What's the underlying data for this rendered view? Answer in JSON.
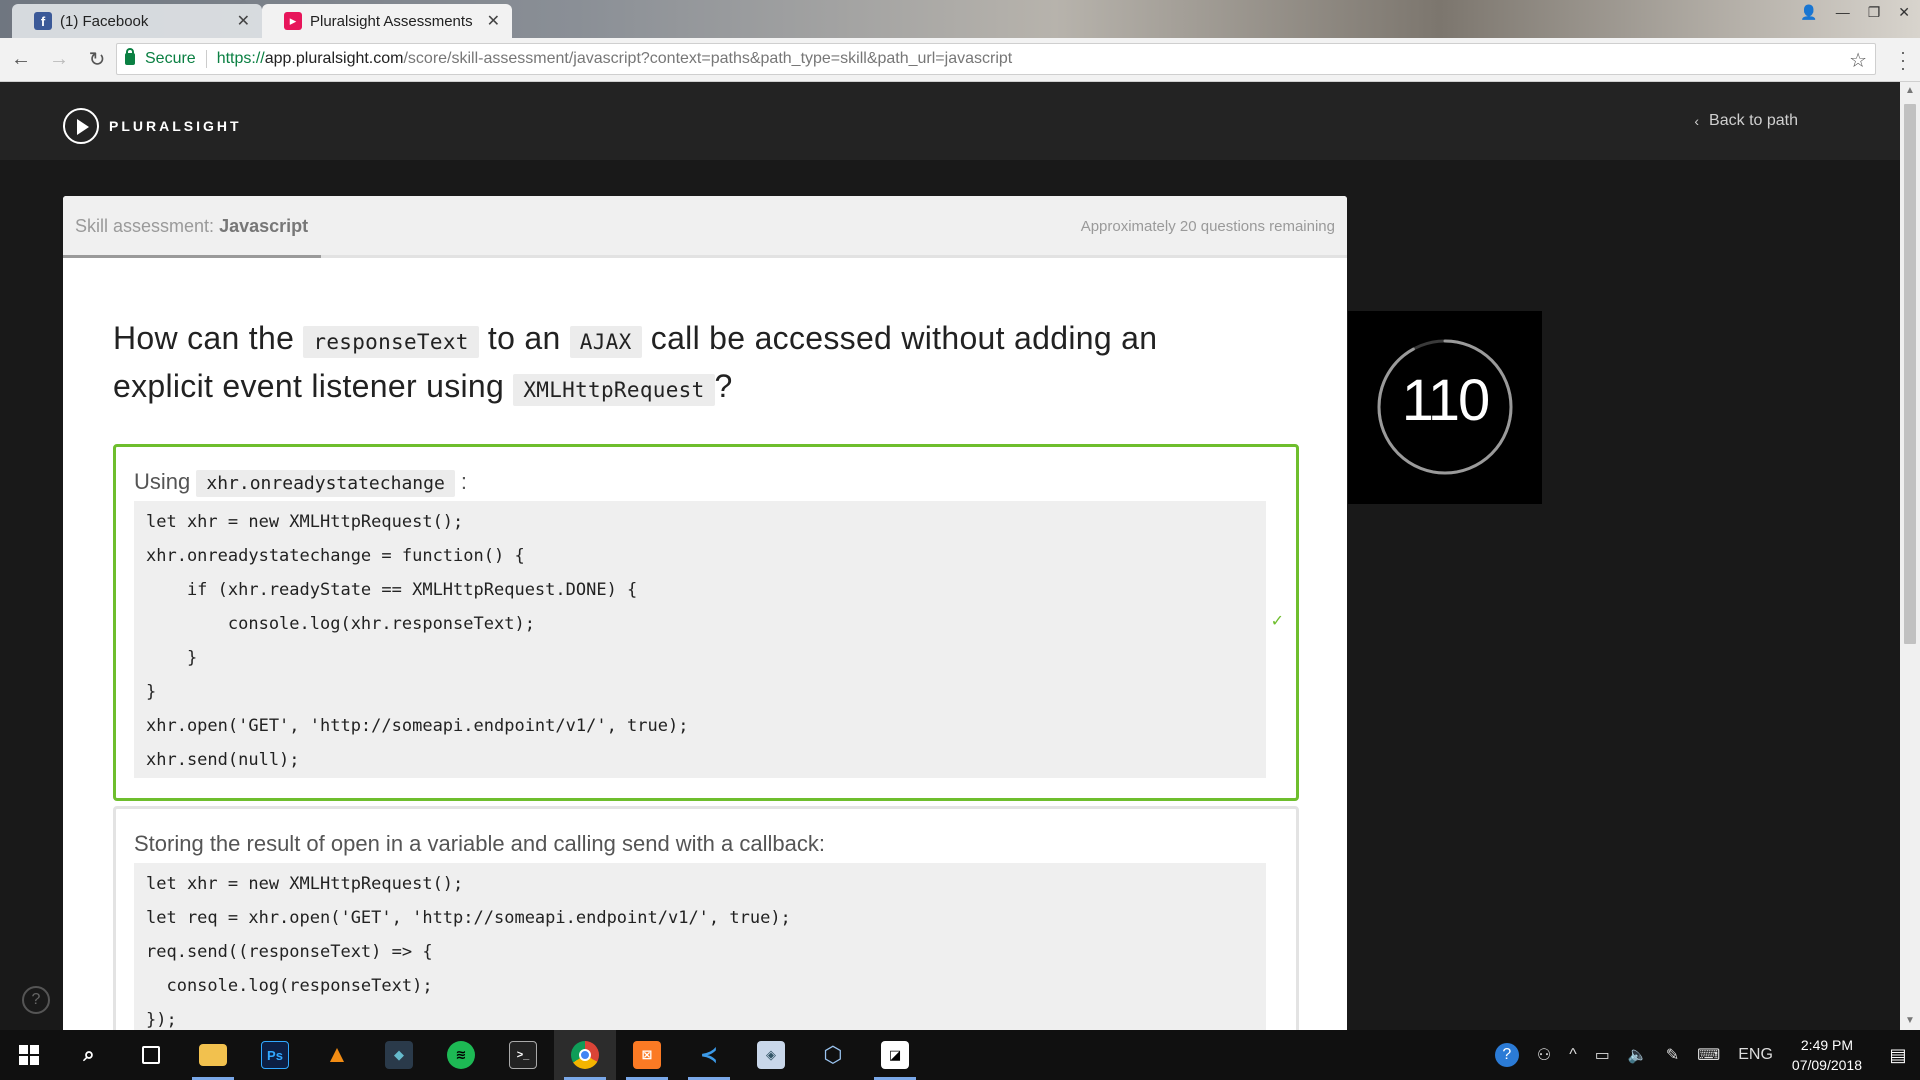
{
  "browser": {
    "tabs": [
      {
        "title": "(1) Facebook",
        "icon": "facebook-icon",
        "active": false
      },
      {
        "title": "Pluralsight Assessments",
        "icon": "pluralsight-icon",
        "active": true
      }
    ],
    "secure_label": "Secure",
    "url": {
      "scheme": "https://",
      "host": "app.pluralsight.com",
      "path": "/score/skill-assessment/javascript?context=paths&path_type=skill&path_url=javascript"
    }
  },
  "site": {
    "logo_text": "PLURALSIGHT",
    "back_link": "Back to path"
  },
  "assessment": {
    "label_prefix": "Skill assessment:",
    "label_topic": "Javascript",
    "remaining": "Approximately 20 questions remaining",
    "question": {
      "part1": "How can the",
      "code1": "responseText",
      "part2": "to an",
      "code2": "AJAX",
      "part3": "call be accessed without adding an explicit event listener using",
      "code3": "XMLHttpRequest",
      "part4": "?"
    },
    "choices": [
      {
        "lead_text": "Using",
        "lead_code": "xhr.onreadystatechange",
        "lead_suffix": ":",
        "selected": true,
        "code": "let xhr = new XMLHttpRequest();\nxhr.onreadystatechange = function() {\n    if (xhr.readyState == XMLHttpRequest.DONE) {\n        console.log(xhr.responseText);\n    }\n}\nxhr.open('GET', 'http://someapi.endpoint/v1/', true);\nxhr.send(null);"
      },
      {
        "lead_text": "Storing the result of open in a variable and calling send with a callback:",
        "selected": false,
        "code": "let xhr = new XMLHttpRequest();\nlet req = xhr.open('GET', 'http://someapi.endpoint/v1/', true);\nreq.send((responseText) => {\n  console.log(responseText);\n});"
      }
    ],
    "timer": {
      "value": "110",
      "progress": 0.92
    },
    "help_label": "?"
  },
  "taskbar": {
    "apps": [
      {
        "name": "search-icon"
      },
      {
        "name": "task-view-icon"
      },
      {
        "name": "file-explorer-icon"
      },
      {
        "name": "photoshop-icon",
        "label": "Ps"
      },
      {
        "name": "vlc-icon"
      },
      {
        "name": "app-icon"
      },
      {
        "name": "spotify-icon"
      },
      {
        "name": "terminal-icon"
      },
      {
        "name": "chrome-icon"
      },
      {
        "name": "xampp-icon"
      },
      {
        "name": "vscode-icon"
      },
      {
        "name": "cube-icon"
      },
      {
        "name": "virtualbox-icon"
      },
      {
        "name": "sticky-notes-icon"
      }
    ],
    "tray": {
      "language": "ENG",
      "time": "2:49 PM",
      "date": "07/09/2018"
    }
  },
  "colors": {
    "accent_green": "#6ebe2d",
    "brand_pink": "#e7155a",
    "header_bg": "#232323"
  }
}
